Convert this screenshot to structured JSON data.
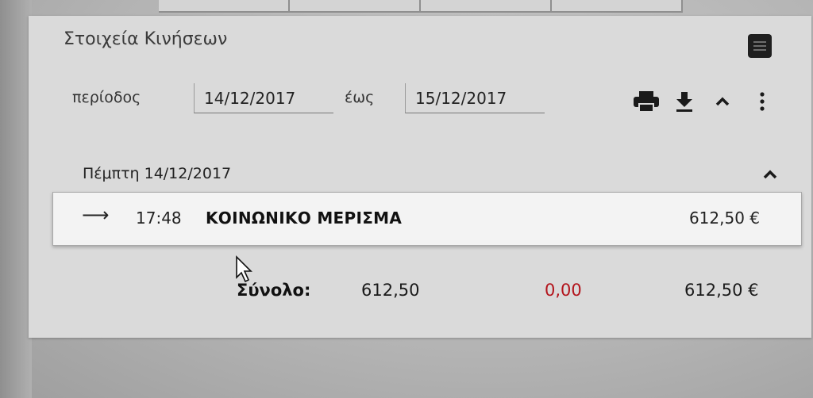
{
  "panel": {
    "title": "Στοιχεία Κινήσεων"
  },
  "filter": {
    "period_label": "περίοδος",
    "from_value": "14/12/2017",
    "to_label": "έως",
    "to_value": "15/12/2017"
  },
  "toolbar": {
    "icons": [
      "print-icon",
      "download-icon",
      "chevron-up-icon",
      "more-vertical-icon"
    ]
  },
  "day_group": {
    "header": "Πέμπτη 14/12/2017",
    "entries": [
      {
        "direction_icon": "arrow-right-icon",
        "time": "17:48",
        "description": "ΚΟΙΝΩΝΙΚΟ ΜΕΡΙΣΜΑ",
        "amount": "612,50 €"
      }
    ]
  },
  "totals": {
    "label": "Σύνολο:",
    "credit": "612,50",
    "debit": "0,00",
    "balance": "612,50 €"
  },
  "colors": {
    "panel_background": "#dadada",
    "row_background": "#f3f3f3",
    "debit_red": "#b3141c"
  }
}
